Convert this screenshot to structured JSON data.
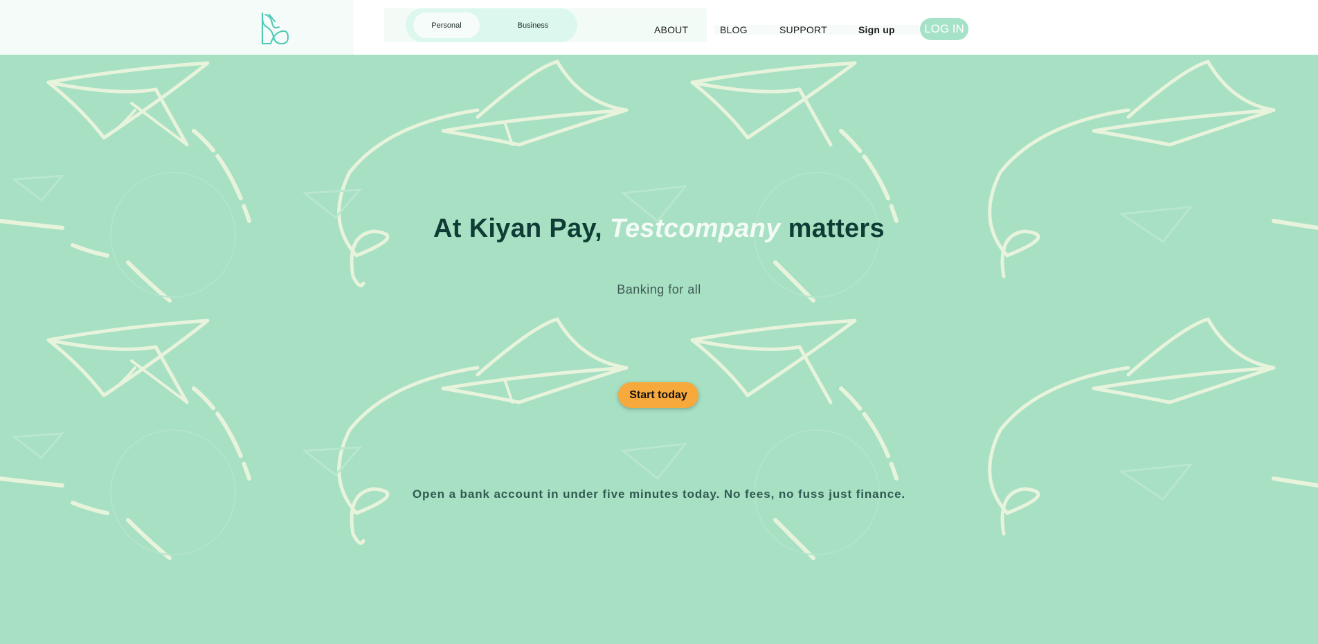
{
  "header": {
    "logo_icon": "kiyan-pay-logo-icon",
    "account_toggle": {
      "personal_label": "Personal",
      "business_label": "Business",
      "selected": "Personal"
    },
    "nav": {
      "about": "ABOUT",
      "blog": "BLOG",
      "support": "SUPPORT",
      "sign_up": "Sign up",
      "log_in": "LOG IN"
    }
  },
  "hero": {
    "background_icon": "paper-plane-pattern",
    "title_prefix": "At Kiyan Pay,",
    "title_highlight": "Testcompany",
    "title_suffix": "matters",
    "subtitle": "Banking for all",
    "cta_label": "Start today",
    "description": "Open a bank account in under five minutes today. No fees, no fuss just finance."
  },
  "colors": {
    "hero_background": "#a7e0c3",
    "title_text": "#0f3d35",
    "highlight_text": "#f4fbf7",
    "cta_background": "#f7a93b",
    "login_background": "#a6e2c8",
    "logo_stroke": "#4cc9b3"
  }
}
